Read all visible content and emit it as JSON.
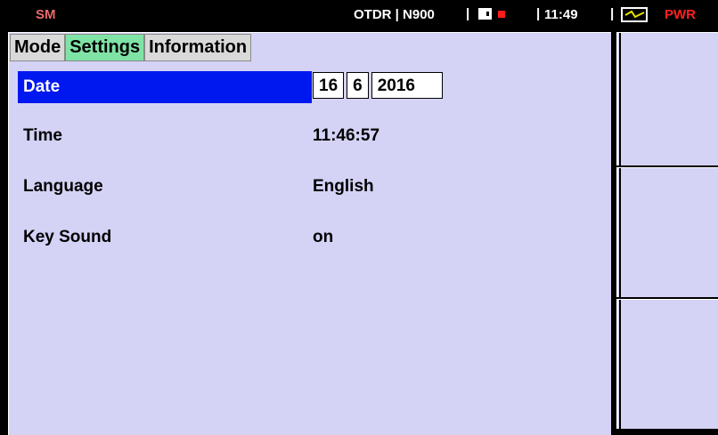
{
  "status_bar": {
    "mode": "SM",
    "device": "OTDR | N900",
    "separator": "|",
    "time": "11:49",
    "power": "PWR",
    "colors": {
      "mode": "#e86a6a",
      "record": "#ff1b1b",
      "power": "#ff2020"
    },
    "icons": [
      "sd-card-icon",
      "record-icon",
      "battery-charging-icon"
    ]
  },
  "tabs": [
    {
      "label": "Mode",
      "active": false
    },
    {
      "label": "Settings",
      "active": true
    },
    {
      "label": "Information",
      "active": false
    }
  ],
  "settings": {
    "date": {
      "label": "Date",
      "day": "16",
      "month": "6",
      "year": "2016"
    },
    "time": {
      "label": "Time",
      "value": "11:46:57"
    },
    "language": {
      "label": "Language",
      "value": "English"
    },
    "key_sound": {
      "label": "Key Sound",
      "value": "on"
    }
  },
  "colors": {
    "panel_bg": "#d4d2f5",
    "selection": "#0018f0",
    "active_tab": "#7fe3a6"
  }
}
